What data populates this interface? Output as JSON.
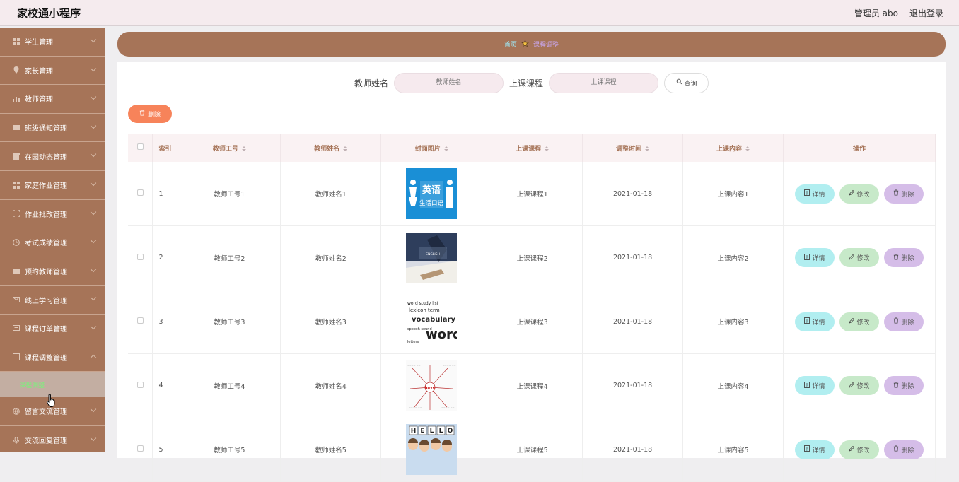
{
  "header": {
    "title": "家校通小程序",
    "user": "管理员 abo",
    "logout": "退出登录"
  },
  "sidebar": {
    "items": [
      {
        "label": "学生管理",
        "icon": "grid-icon"
      },
      {
        "label": "家长管理",
        "icon": "location-icon"
      },
      {
        "label": "教师管理",
        "icon": "bar-chart-icon"
      },
      {
        "label": "班级通知管理",
        "icon": "chat-icon"
      },
      {
        "label": "在园动态管理",
        "icon": "shop-icon"
      },
      {
        "label": "家庭作业管理",
        "icon": "grid-icon"
      },
      {
        "label": "作业批改管理",
        "icon": "fullscreen-icon"
      },
      {
        "label": "考试成绩管理",
        "icon": "clock-icon"
      },
      {
        "label": "预约教师管理",
        "icon": "chat-icon"
      },
      {
        "label": "线上学习管理",
        "icon": "mail-icon"
      },
      {
        "label": "课程订单管理",
        "icon": "message-icon"
      },
      {
        "label": "课程调整管理",
        "icon": "doc-icon"
      }
    ],
    "sub_item": "课程调整",
    "after_items": [
      {
        "label": "留言交流管理",
        "icon": "globe-icon"
      },
      {
        "label": "交流回复管理",
        "icon": "mic-icon"
      }
    ]
  },
  "breadcrumb": {
    "home": "首页",
    "current": "课程调整"
  },
  "search": {
    "teacher_name_label": "教师姓名",
    "teacher_name_placeholder": "教师姓名",
    "course_label": "上课课程",
    "course_placeholder": "上课课程",
    "query_button": "查询"
  },
  "toolbar": {
    "delete_label": "删除"
  },
  "table": {
    "columns": [
      "索引",
      "教师工号",
      "教师姓名",
      "封面图片",
      "上课课程",
      "调整时间",
      "上课内容",
      "操作"
    ],
    "rows": [
      {
        "index": "1",
        "teacher_id": "教师工号1",
        "teacher_name": "教师姓名1",
        "course": "上课课程1",
        "time": "2021-01-18",
        "content": "上课内容1",
        "cover": "english-cover"
      },
      {
        "index": "2",
        "teacher_id": "教师工号2",
        "teacher_name": "教师姓名2",
        "course": "上课课程2",
        "time": "2021-01-18",
        "content": "上课内容2",
        "cover": "study-cover"
      },
      {
        "index": "3",
        "teacher_id": "教师工号3",
        "teacher_name": "教师姓名3",
        "course": "上课课程3",
        "time": "2021-01-18",
        "content": "上课内容3",
        "cover": "words-cover"
      },
      {
        "index": "4",
        "teacher_id": "教师工号4",
        "teacher_name": "教师姓名4",
        "course": "上课课程4",
        "time": "2021-01-18",
        "content": "上课内容4",
        "cover": "mindmap-cover"
      },
      {
        "index": "5",
        "teacher_id": "教师工号5",
        "teacher_name": "教师姓名5",
        "course": "上课课程5",
        "time": "2021-01-18",
        "content": "上课内容5",
        "cover": "hello-cover"
      }
    ],
    "actions": {
      "detail": "详情",
      "edit": "修改",
      "delete": "删除"
    },
    "cover_text": {
      "english": "英语",
      "english_sub": "生活口语",
      "words": "words",
      "vocabulary": "vocabulary",
      "have": "have",
      "hello": "HELLO",
      "study_caption": "ENGLISH"
    }
  },
  "colors": {
    "sidebar": "#a67458",
    "accent_delete": "#f7835a",
    "detail": "#b1eef0",
    "edit": "#c7e9c9",
    "remove": "#d5bde8"
  }
}
